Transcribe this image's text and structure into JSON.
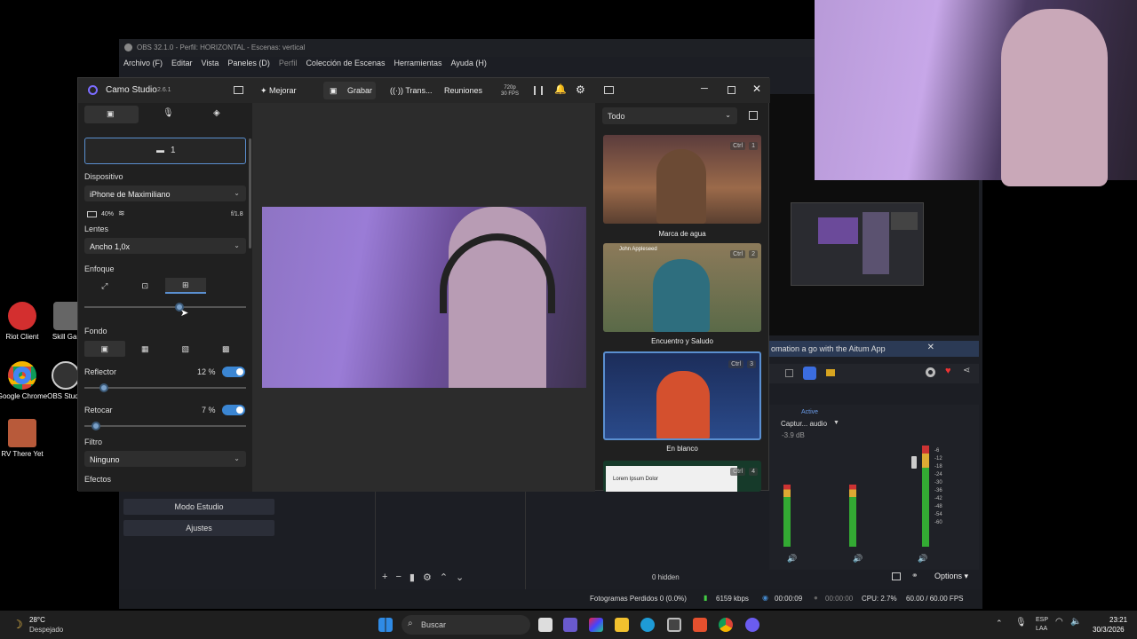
{
  "desktop": {
    "icons": [
      {
        "label": "Riot Client"
      },
      {
        "label": "Skill Ga..."
      },
      {
        "label": "Google Chrome"
      },
      {
        "label": "OBS Studio"
      },
      {
        "label": "RV There Yet"
      }
    ]
  },
  "obs": {
    "title": "OBS 32.1.0 - Perfil: HORIZONTAL - Escenas: vertical",
    "menu": [
      "Archivo (F)",
      "Editar",
      "Vista",
      "Paneles (D)",
      "Perfil",
      "Colección de Escenas",
      "Herramientas",
      "Ayuda (H)"
    ],
    "notification": "omation a go with the Aitum App",
    "studio_mode_label": "Modo Estudio",
    "settings_label": "Ajustes",
    "mixer_active": "Active",
    "mixer_source": "Captur... audio",
    "mixer_db": "-3.9 dB",
    "meter_scale": [
      "-6",
      "-12",
      "-18",
      "-24",
      "-30",
      "-36",
      "-42",
      "-48",
      "-54",
      "-60"
    ],
    "hidden_label": "0 hidden",
    "options_label": "Options",
    "status": {
      "dropped": "Fotogramas Perdidos 0 (0.0%)",
      "bitrate": "6159 kbps",
      "rec_time": "00:00:09",
      "stream_time": "00:00:00",
      "cpu": "CPU: 2.7%",
      "fps": "60.00 / 60.00 FPS"
    }
  },
  "camo": {
    "app_name": "Camo Studio",
    "version": "2.6.1",
    "toolbar": {
      "improve": "Mejorar",
      "record": "Grabar",
      "stream": "Trans...",
      "meetings": "Reuniones",
      "res": "720p",
      "fps": "30 FPS"
    },
    "camera_number": "1",
    "device_label": "Dispositivo",
    "device_value": "iPhone de Maximiliano",
    "battery": "40%",
    "aperture": "f/1.8",
    "lens_label": "Lentes",
    "lens_value": "Ancho 1,0x",
    "focus_label": "Enfoque",
    "focus_level": 0.59,
    "background_label": "Fondo",
    "reflector_label": "Reflector",
    "reflector_value": "12 %",
    "reflector_level": 0.12,
    "retouch_label": "Retocar",
    "retouch_value": "7 %",
    "retouch_level": 0.07,
    "filter_label": "Filtro",
    "filter_value": "Ninguno",
    "effects_label": "Efectos",
    "overlay_filter": "Todo",
    "overlays": [
      {
        "ctrl": "Ctrl",
        "num": "1",
        "caption": "Marca de agua"
      },
      {
        "ctrl": "Ctrl",
        "num": "2",
        "caption": "Encuentro y Saludo",
        "name": "John Appleseed"
      },
      {
        "ctrl": "Ctrl",
        "num": "3",
        "caption": "En blanco"
      },
      {
        "ctrl": "Ctrl",
        "num": "4",
        "caption": "",
        "text": "Lorem Ipsum Dolor"
      }
    ]
  },
  "taskbar": {
    "weather_temp": "28°C",
    "weather_desc": "Despejado",
    "search": "Buscar",
    "lang": "ESP",
    "lang2": "LAA",
    "time": "23:21",
    "date": "30/3/2026"
  }
}
